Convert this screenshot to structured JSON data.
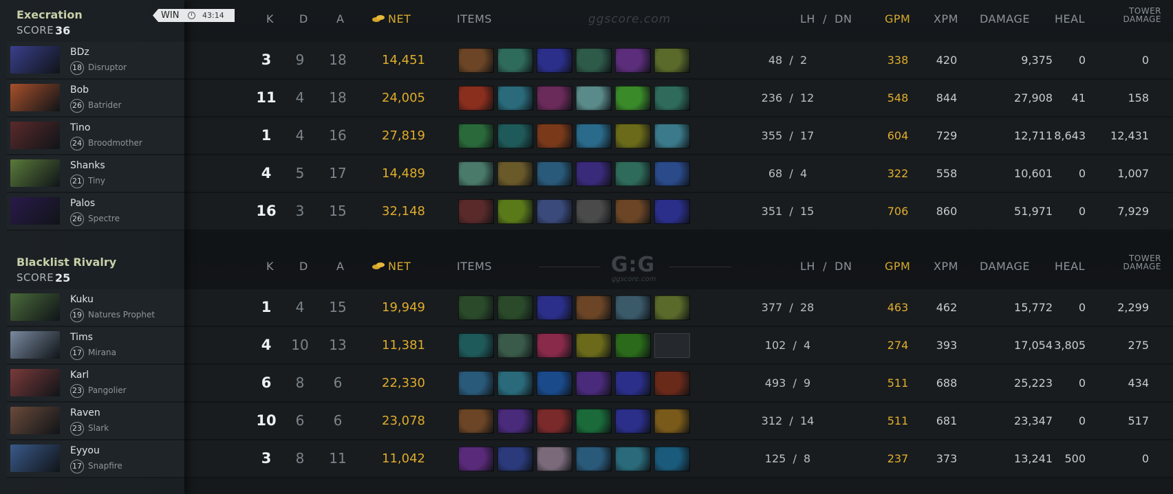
{
  "match": {
    "result": "WIN",
    "duration": "43:14"
  },
  "columns": {
    "k": "K",
    "d": "D",
    "a": "A",
    "net": "NET",
    "items": "ITEMS",
    "lh_dn": "LH  /  DN",
    "gpm": "GPM",
    "xpm": "XPM",
    "damage": "DAMAGE",
    "heal": "HEAL",
    "tower_line1": "TOWER",
    "tower_line2": "DAMAGE"
  },
  "watermark": {
    "site": "ggscore.com",
    "logo": "G:G"
  },
  "score_label": "SCORE",
  "teams": [
    {
      "name": "Execration",
      "score": "36",
      "players": [
        {
          "name": "BDz",
          "level": "18",
          "hero": "Disruptor",
          "k": "3",
          "d": "9",
          "a": "18",
          "net": "14,451",
          "lhdn": "48  /  2",
          "gpm": "338",
          "xpm": "420",
          "damage": "9,375",
          "heal": "0",
          "tower": "0",
          "portrait": "#3a3f8c",
          "items": [
            "#6b4526",
            "#2f6b5a",
            "#2b2f8a",
            "#2e5a4a",
            "#5b2d7a",
            "#5a6a2a"
          ]
        },
        {
          "name": "Bob",
          "level": "26",
          "hero": "Batrider",
          "k": "11",
          "d": "4",
          "a": "18",
          "net": "24,005",
          "lhdn": "236  /  12",
          "gpm": "548",
          "xpm": "844",
          "damage": "27,908",
          "heal": "41",
          "tower": "158",
          "portrait": "#a8502a",
          "items": [
            "#8a2e1e",
            "#2a6a7a",
            "#6a2a5a",
            "#5a8a8a",
            "#3a8a2a",
            "#2f6b5a"
          ]
        },
        {
          "name": "Tino",
          "level": "24",
          "hero": "Broodmother",
          "k": "1",
          "d": "4",
          "a": "16",
          "net": "27,819",
          "lhdn": "355  /  17",
          "gpm": "604",
          "xpm": "729",
          "damage": "12,711",
          "heal": "8,643",
          "tower": "12,431",
          "portrait": "#5a2a2a",
          "items": [
            "#2a6a3a",
            "#1f5a5a",
            "#7a3a1a",
            "#2a6a8a",
            "#6a6a1a",
            "#3a7a8a"
          ]
        },
        {
          "name": "Shanks",
          "level": "21",
          "hero": "Tiny",
          "k": "4",
          "d": "5",
          "a": "17",
          "net": "14,489",
          "lhdn": "68  /  4",
          "gpm": "322",
          "xpm": "558",
          "damage": "10,601",
          "heal": "0",
          "tower": "1,007",
          "portrait": "#5a7a3a",
          "items": [
            "#4a7a6a",
            "#6a5a2a",
            "#2a5a7a",
            "#3a2a7a",
            "#2f6b5a",
            "#2a4a8a"
          ]
        },
        {
          "name": "Palos",
          "level": "26",
          "hero": "Spectre",
          "k": "16",
          "d": "3",
          "a": "15",
          "net": "32,148",
          "lhdn": "351  /  15",
          "gpm": "706",
          "xpm": "860",
          "damage": "51,971",
          "heal": "0",
          "tower": "7,929",
          "portrait": "#2a1a4a",
          "items": [
            "#5a2a2a",
            "#5a7a1a",
            "#3a4a7a",
            "#4a4a4a",
            "#6b4526",
            "#2b2f8a"
          ]
        }
      ]
    },
    {
      "name": "Blacklist Rivalry",
      "score": "25",
      "players": [
        {
          "name": "Kuku",
          "level": "19",
          "hero": "Natures Prophet",
          "k": "1",
          "d": "4",
          "a": "15",
          "net": "19,949",
          "lhdn": "377  /  28",
          "gpm": "463",
          "xpm": "462",
          "damage": "15,772",
          "heal": "0",
          "tower": "2,299",
          "portrait": "#4a6a3a",
          "items": [
            "#2a4a2a",
            "#2a4a2a",
            "#2b2f8a",
            "#6b4526",
            "#3a5a6a",
            "#5a6a2a"
          ]
        },
        {
          "name": "Tims",
          "level": "17",
          "hero": "Mirana",
          "k": "4",
          "d": "10",
          "a": "13",
          "net": "11,381",
          "lhdn": "102  /  4",
          "gpm": "274",
          "xpm": "393",
          "damage": "17,054",
          "heal": "3,805",
          "tower": "275",
          "portrait": "#7a8aa0",
          "items": [
            "#1f5a5a",
            "#3a5a4a",
            "#8a2a4a",
            "#6a6a1a",
            "#2a6a1a",
            ""
          ]
        },
        {
          "name": "Karl",
          "level": "23",
          "hero": "Pangolier",
          "k": "6",
          "d": "8",
          "a": "6",
          "net": "22,330",
          "lhdn": "493  /  9",
          "gpm": "511",
          "xpm": "688",
          "damage": "25,223",
          "heal": "0",
          "tower": "434",
          "portrait": "#7a3a3a",
          "items": [
            "#2a5a7a",
            "#2a6a7a",
            "#1a4a8a",
            "#4a2a7a",
            "#2b2f8a",
            "#6a2a1a"
          ]
        },
        {
          "name": "Raven",
          "level": "23",
          "hero": "Slark",
          "k": "10",
          "d": "6",
          "a": "6",
          "net": "23,078",
          "lhdn": "312  /  14",
          "gpm": "511",
          "xpm": "681",
          "damage": "23,347",
          "heal": "0",
          "tower": "517",
          "portrait": "#6a4a3a",
          "items": [
            "#6b4526",
            "#4a2a7a",
            "#7a2a2a",
            "#1a6a3a",
            "#2b2f8a",
            "#7a5a1a"
          ]
        },
        {
          "name": "Eyyou",
          "level": "17",
          "hero": "Snapfire",
          "k": "3",
          "d": "8",
          "a": "11",
          "net": "11,042",
          "lhdn": "125  /  8",
          "gpm": "237",
          "xpm": "373",
          "damage": "13,241",
          "heal": "500",
          "tower": "0",
          "portrait": "#3a5a8a",
          "items": [
            "#5a2a7a",
            "#2a3a7a",
            "#7a6a7a",
            "#2a5a7a",
            "#2a6a7a",
            "#1a5a7a"
          ]
        }
      ]
    }
  ]
}
